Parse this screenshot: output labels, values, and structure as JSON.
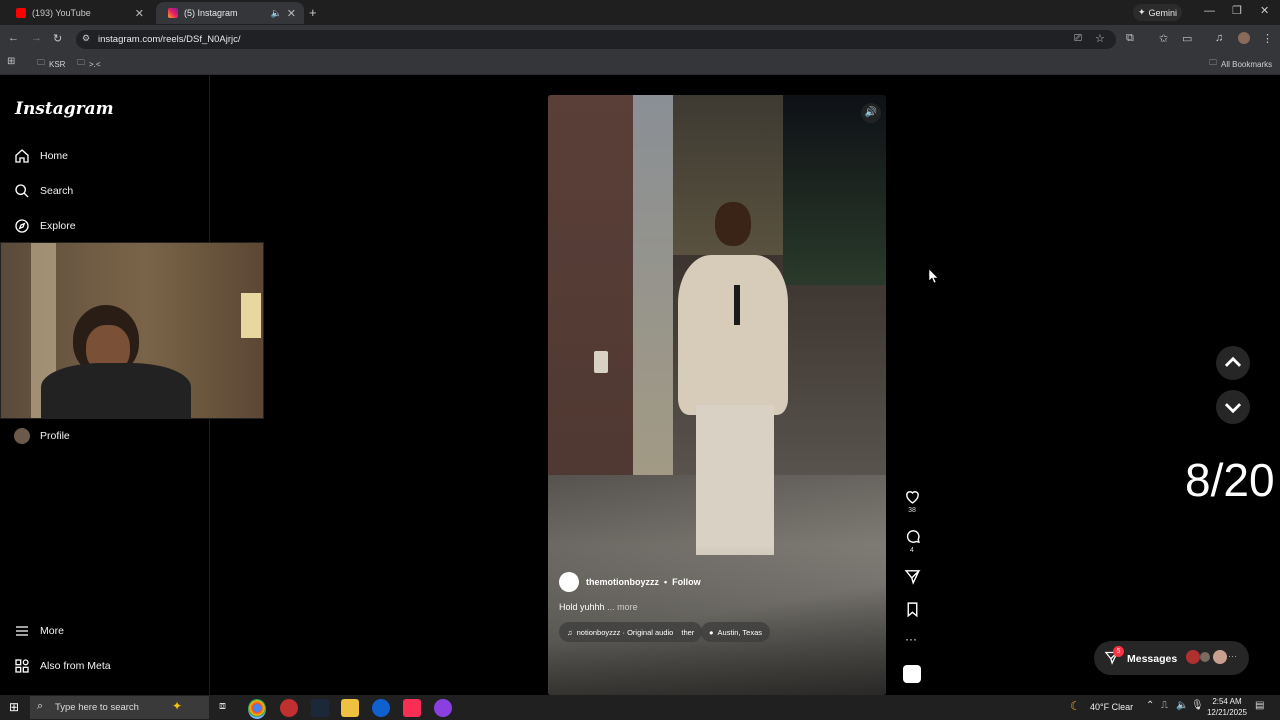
{
  "browser": {
    "tabs": [
      {
        "label": "(193) YouTube",
        "active": false
      },
      {
        "label": "(5) Instagram",
        "active": true
      }
    ],
    "gemini_label": "Gemini",
    "url": "instagram.com/reels/DSf_N0Ajrjc/",
    "bookmarks": [
      "KSR",
      ">.<"
    ],
    "all_bookmarks": "All Bookmarks"
  },
  "instagram": {
    "logo": "Instagram",
    "nav": {
      "home": "Home",
      "search": "Search",
      "explore": "Explore",
      "profile": "Profile",
      "more": "More",
      "meta": "Also from Meta"
    },
    "reel": {
      "username": "themotionboyzzz",
      "dot": "•",
      "follow": "Follow",
      "caption": "Hold yuhhh",
      "more": "... more",
      "audio": "notionboyzzz · Original audio",
      "audio_tail": "ther",
      "location": "Austin, Texas",
      "likes": "38",
      "comments": "4"
    },
    "messages_label": "Messages",
    "messages_badge": "5"
  },
  "overlay_counter": "8/20",
  "taskbar": {
    "search_placeholder": "Type here to search",
    "weather": "40°F  Clear",
    "time": "2:54 AM",
    "date": "12/21/2025"
  },
  "colors": {
    "instagram_bg": "#000000",
    "chrome_toolbar": "#35363a",
    "youtube_red": "#ff0000",
    "badge_red": "#ff3040"
  }
}
